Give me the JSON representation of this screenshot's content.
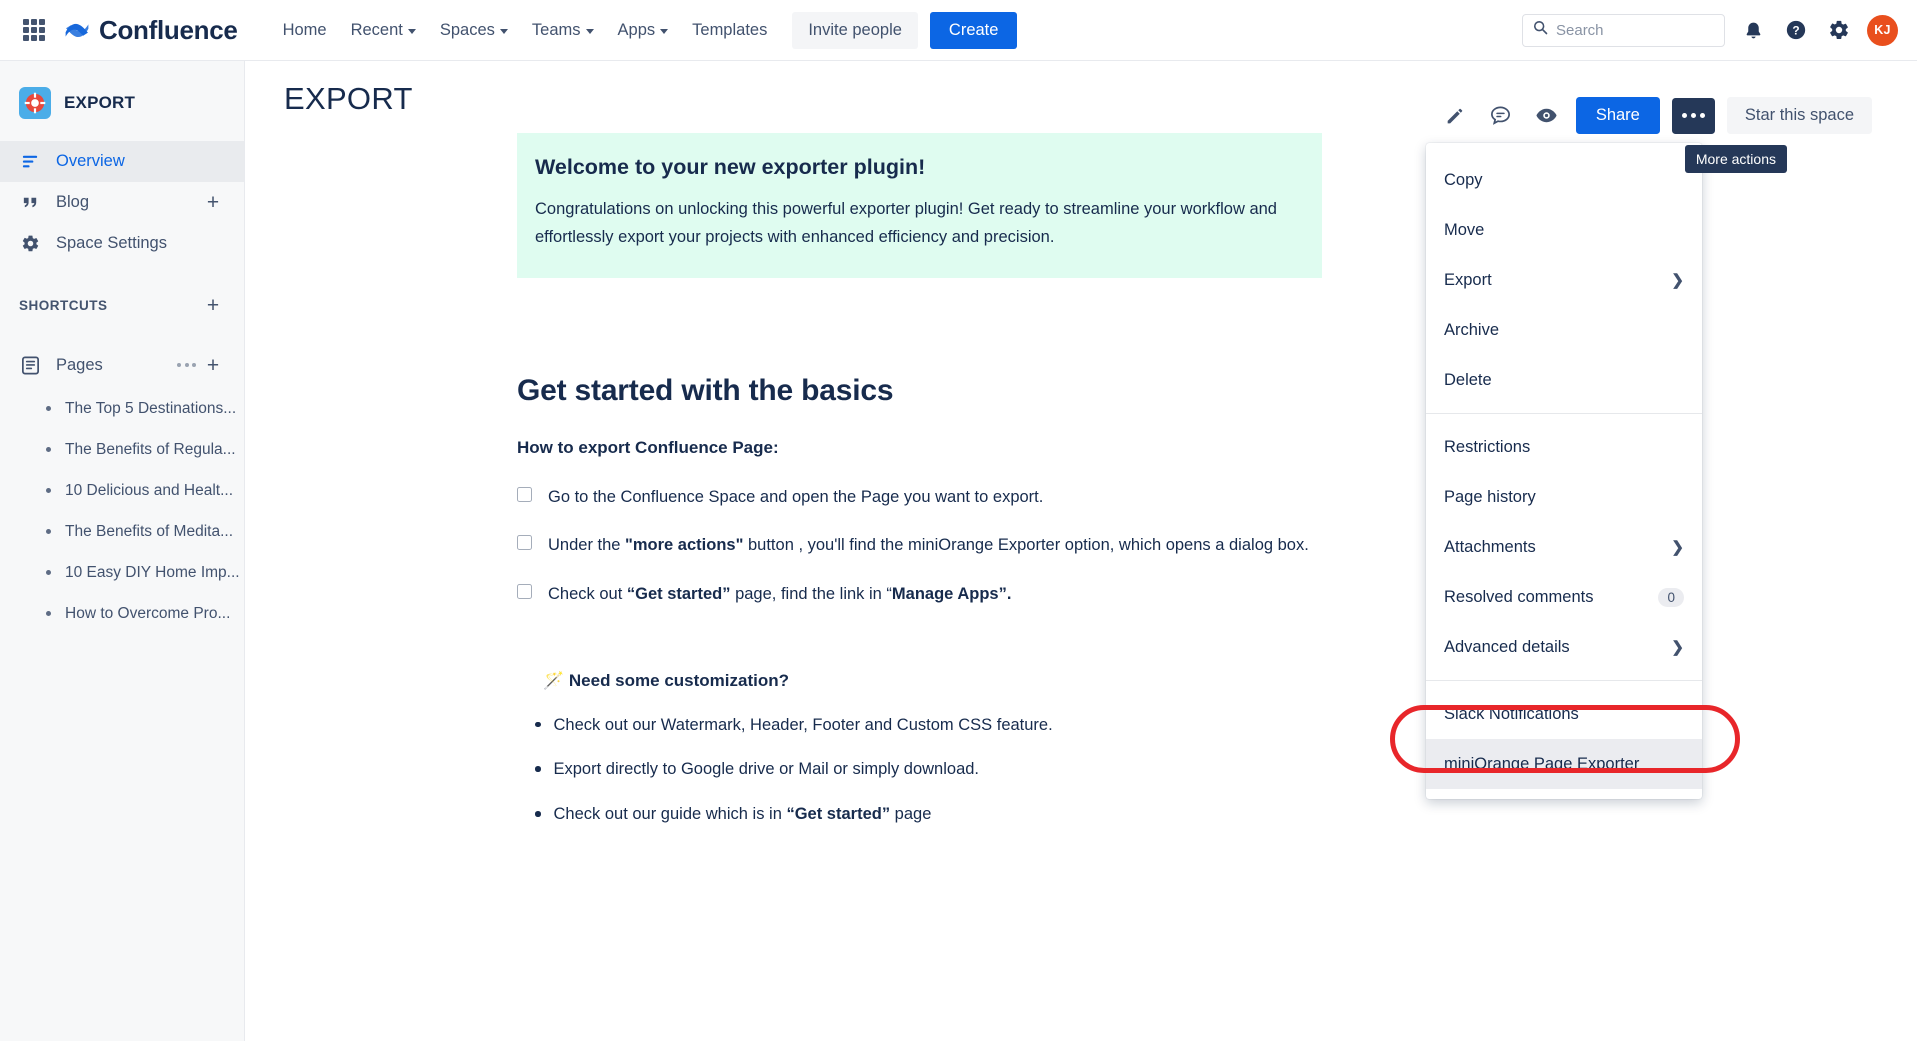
{
  "topnav": {
    "brand": "Confluence",
    "items": [
      {
        "label": "Home",
        "has_caret": false
      },
      {
        "label": "Recent",
        "has_caret": true
      },
      {
        "label": "Spaces",
        "has_caret": true
      },
      {
        "label": "Teams",
        "has_caret": true
      },
      {
        "label": "Apps",
        "has_caret": true
      },
      {
        "label": "Templates",
        "has_caret": false
      }
    ],
    "invite_label": "Invite people",
    "create_label": "Create",
    "search_placeholder": "Search",
    "avatar_initials": "KJ"
  },
  "sidebar": {
    "space_name": "EXPORT",
    "nav": [
      {
        "label": "Overview",
        "icon": "overview-icon",
        "active": true,
        "plus": false
      },
      {
        "label": "Blog",
        "icon": "blog-icon",
        "active": false,
        "plus": true
      },
      {
        "label": "Space Settings",
        "icon": "gear-icon",
        "active": false,
        "plus": false
      }
    ],
    "shortcuts_title": "SHORTCUTS",
    "pages_label": "Pages",
    "pages": [
      {
        "label": "The Top 5 Destinations..."
      },
      {
        "label": "The Benefits of Regula..."
      },
      {
        "label": "10 Delicious and Healt..."
      },
      {
        "label": "The Benefits of Medita..."
      },
      {
        "label": "10 Easy DIY Home Imp..."
      },
      {
        "label": "How to Overcome Pro..."
      }
    ]
  },
  "page": {
    "title": "EXPORT",
    "toolbar": {
      "share_label": "Share",
      "star_label": "Star this space",
      "more_tooltip": "More actions"
    },
    "banner": {
      "title": "Welcome to your new exporter plugin!",
      "text": "Congratulations on unlocking this powerful exporter plugin! Get ready to streamline your workflow and effortlessly export your projects with enhanced efficiency and precision."
    },
    "heading": "Get started with the basics",
    "subheading": "How to export Confluence Page:",
    "checklist": [
      {
        "text_parts": [
          {
            "t": "Go to the Confluence Space and open the Page you want to export.",
            "b": false
          }
        ]
      },
      {
        "text_parts": [
          {
            "t": "Under the ",
            "b": false
          },
          {
            "t": "\"more actions\"",
            "b": true
          },
          {
            "t": " button , you'll find the miniOrange Exporter option, which opens a dialog box.",
            "b": false
          }
        ]
      },
      {
        "text_parts": [
          {
            "t": "Check out ",
            "b": false
          },
          {
            "t": "“Get started”",
            "b": true
          },
          {
            "t": " page, find the link in “",
            "b": false
          },
          {
            "t": "Manage Apps”.",
            "b": true
          }
        ]
      }
    ],
    "custom_heading": "🪄 Need some customization?",
    "bullets": [
      {
        "parts": [
          {
            "t": "Check out our Watermark, Header, Footer and Custom CSS feature.",
            "b": false
          }
        ]
      },
      {
        "parts": [
          {
            "t": "Export directly to Google drive or Mail or simply download.",
            "b": false
          }
        ]
      },
      {
        "parts": [
          {
            "t": "Check out our guide which is in ",
            "b": false
          },
          {
            "t": "“Get started”",
            "b": true
          },
          {
            "t": " page",
            "b": false
          }
        ]
      }
    ]
  },
  "menu": {
    "groups": [
      {
        "items": [
          {
            "label": "Copy",
            "chevron": false,
            "badge": null,
            "highlight": false
          },
          {
            "label": "Move",
            "chevron": false,
            "badge": null,
            "highlight": false
          },
          {
            "label": "Export",
            "chevron": true,
            "badge": null,
            "highlight": false
          },
          {
            "label": "Archive",
            "chevron": false,
            "badge": null,
            "highlight": false
          },
          {
            "label": "Delete",
            "chevron": false,
            "badge": null,
            "highlight": false
          }
        ]
      },
      {
        "items": [
          {
            "label": "Restrictions",
            "chevron": false,
            "badge": null,
            "highlight": false
          },
          {
            "label": "Page history",
            "chevron": false,
            "badge": null,
            "highlight": false
          },
          {
            "label": "Attachments",
            "chevron": true,
            "badge": null,
            "highlight": false
          },
          {
            "label": "Resolved comments",
            "chevron": false,
            "badge": "0",
            "highlight": false
          },
          {
            "label": "Advanced details",
            "chevron": true,
            "badge": null,
            "highlight": false
          }
        ]
      },
      {
        "items": [
          {
            "label": "Slack Notifications",
            "chevron": false,
            "badge": null,
            "highlight": false
          },
          {
            "label": "miniOrange Page Exporter",
            "chevron": false,
            "badge": null,
            "highlight": true
          }
        ]
      }
    ]
  },
  "colors": {
    "brand_blue": "#0C66E4",
    "dark_navy": "#253858",
    "banner_green": "#DFFCF0",
    "annotation_red": "#E8262A",
    "avatar_orange": "#E94F1D"
  }
}
